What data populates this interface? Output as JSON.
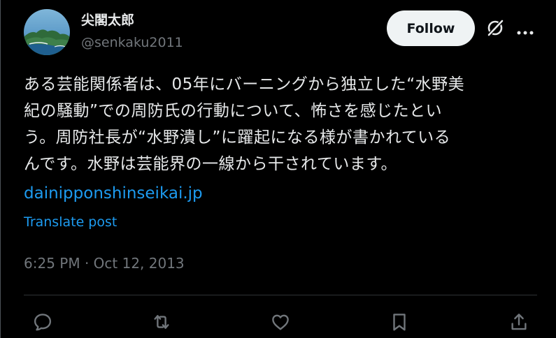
{
  "author": {
    "display_name": "尖閣太郎",
    "handle": "@senkaku2011"
  },
  "header": {
    "follow_label": "Follow",
    "grok_icon": "grok-slash-icon",
    "more_icon": "more-horizontal-icon"
  },
  "tweet": {
    "lines": [
      "ある芸能関係者は、05年にバーニングから独立した“水野美",
      "紀の騒動”での周防氏の行動について、怖さを感じたとい",
      "う。周防社長が“水野潰し”に躍起になる様が書かれている",
      "んです。水野は芸能界の一線から干されています。"
    ],
    "link": "dainipponshinseikai.jp",
    "translate_label": "Translate post",
    "timestamp": "6:25 PM · Oct 12, 2013"
  },
  "actions": [
    {
      "name": "reply-icon"
    },
    {
      "name": "repost-icon"
    },
    {
      "name": "like-icon"
    },
    {
      "name": "bookmark-icon"
    },
    {
      "name": "share-icon"
    }
  ],
  "colors": {
    "background": "#000000",
    "text": "#e7e9ea",
    "secondary": "#71767b",
    "link": "#1d9bf0"
  }
}
